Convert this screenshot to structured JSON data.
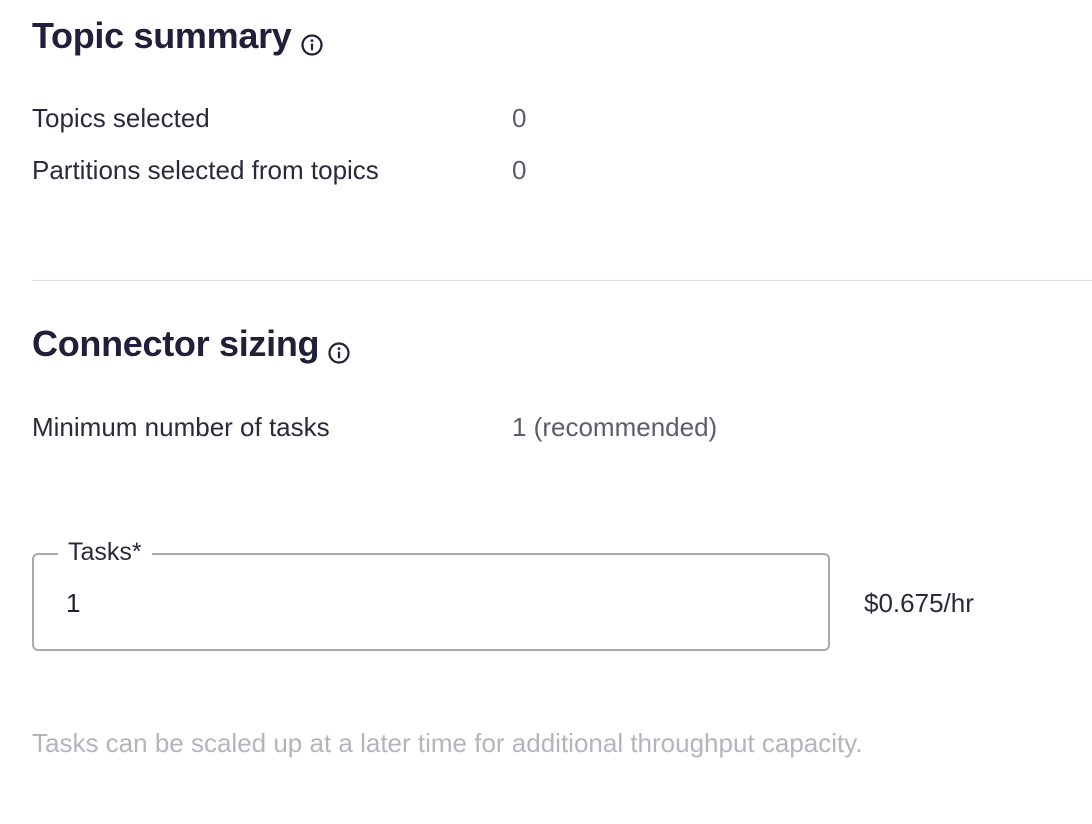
{
  "topic_summary": {
    "title": "Topic summary",
    "rows": [
      {
        "label": "Topics selected",
        "value": "0"
      },
      {
        "label": "Partitions selected from topics",
        "value": "0"
      }
    ]
  },
  "connector_sizing": {
    "title": "Connector sizing",
    "min_tasks_label": "Minimum number of tasks",
    "min_tasks_value": "1 (recommended)",
    "tasks_field": {
      "label": "Tasks*",
      "value": "1"
    },
    "price": "$0.675/hr",
    "helper_text": "Tasks can be scaled up at a later time for additional throughput capacity."
  },
  "icons": {
    "info": "info-circle-icon"
  },
  "colors": {
    "title": "#20203a",
    "text": "#2a2a3c",
    "value": "#5c5c6e",
    "helper": "#b4b4be",
    "border": "#a9a9b3",
    "divider": "#dcdce2"
  }
}
